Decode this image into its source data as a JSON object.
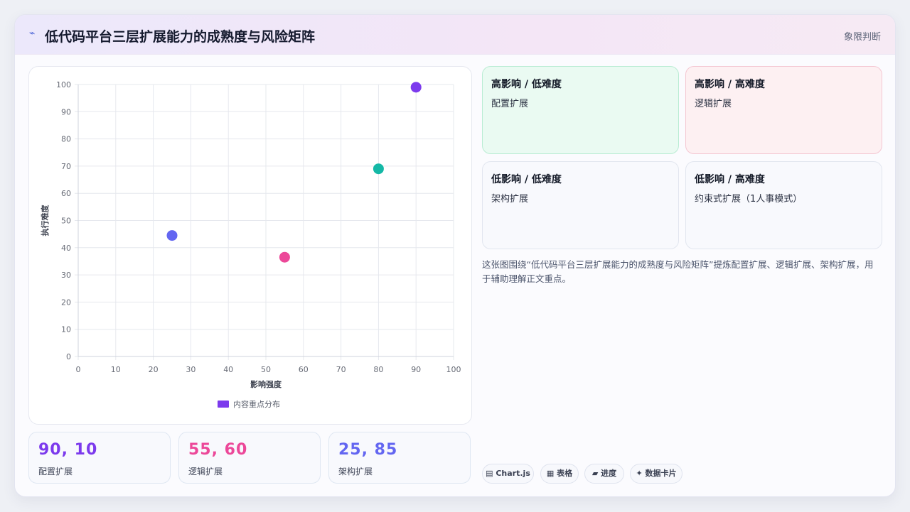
{
  "header": {
    "icon": "bolt-icon",
    "title": "低代码平台三层扩展能力的成熟度与风险矩阵",
    "badge": "象限判断"
  },
  "chart_data": {
    "type": "scatter",
    "xlabel": "影响强度",
    "ylabel": "执行难度",
    "xlim": [
      0,
      100
    ],
    "ylim": [
      0,
      100
    ],
    "xticks": [
      "0",
      "10",
      "20",
      "30",
      "40",
      "50",
      "60",
      "70",
      "80",
      "90",
      "100"
    ],
    "yticks": [
      "0",
      "10",
      "20",
      "30",
      "40",
      "50",
      "60",
      "70",
      "80",
      "90",
      "100"
    ],
    "grid": true,
    "legend": {
      "label": "内容重点分布",
      "color": "#7c3aed",
      "placement": "bottom"
    },
    "points": [
      {
        "x": 90,
        "y": 99,
        "color": "#7c3aed"
      },
      {
        "x": 80,
        "y": 69,
        "color": "#14b8a6"
      },
      {
        "x": 55,
        "y": 36.5,
        "color": "#ec4899"
      },
      {
        "x": 25,
        "y": 44.5,
        "color": "#6366f1"
      }
    ]
  },
  "stats": [
    {
      "value": "90, 10",
      "label": "配置扩展",
      "color": "#7c3aed"
    },
    {
      "value": "55, 60",
      "label": "逻辑扩展",
      "color": "#ec4899"
    },
    {
      "value": "25, 85",
      "label": "架构扩展",
      "color": "#6366f1"
    }
  ],
  "quadrants": [
    {
      "title": "高影响 / 低难度",
      "item": "配置扩展",
      "tone": "green"
    },
    {
      "title": "高影响 / 高难度",
      "item": "逻辑扩展",
      "tone": "red"
    },
    {
      "title": "低影响 / 低难度",
      "item": "架构扩展",
      "tone": "neutral"
    },
    {
      "title": "低影响 / 高难度",
      "item": "约束式扩展（1人事模式）",
      "tone": "neutral"
    }
  ],
  "description": "这张图围绕“低代码平台三层扩展能力的成熟度与风险矩阵”提炼配置扩展、逻辑扩展、架构扩展，用于辅助理解正文重点。",
  "tags": [
    {
      "icon": "chart-icon",
      "glyph": "▤",
      "label": "Chart.js"
    },
    {
      "icon": "table-icon",
      "glyph": "▦",
      "label": "表格"
    },
    {
      "icon": "progress-icon",
      "glyph": "▰",
      "label": "进度"
    },
    {
      "icon": "card-icon",
      "glyph": "✦",
      "label": "数据卡片"
    }
  ]
}
